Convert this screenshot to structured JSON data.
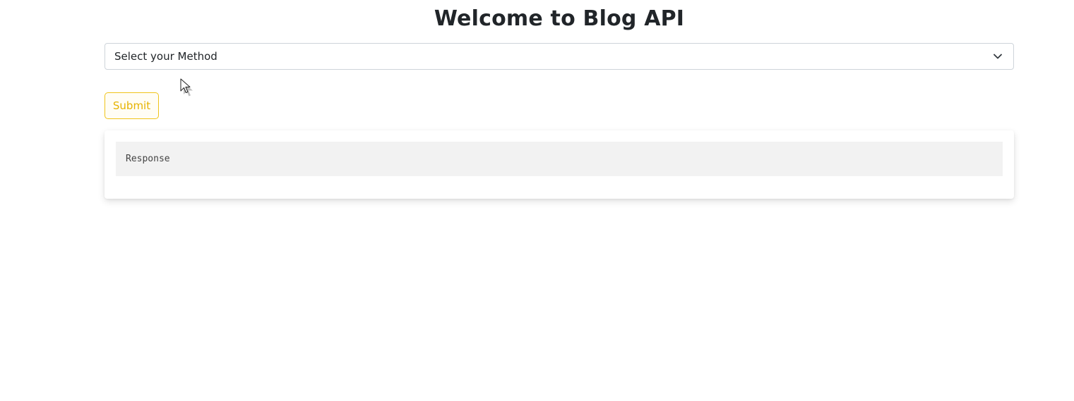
{
  "header": {
    "title": "Welcome to Blog API"
  },
  "form": {
    "method_select": {
      "selected": "Select your Method",
      "icon": "chevron-down-icon"
    },
    "submit_label": "Submit"
  },
  "response": {
    "text": "Response"
  },
  "colors": {
    "submit_accent": "#f0c419",
    "response_background": "#f2f2f2"
  }
}
